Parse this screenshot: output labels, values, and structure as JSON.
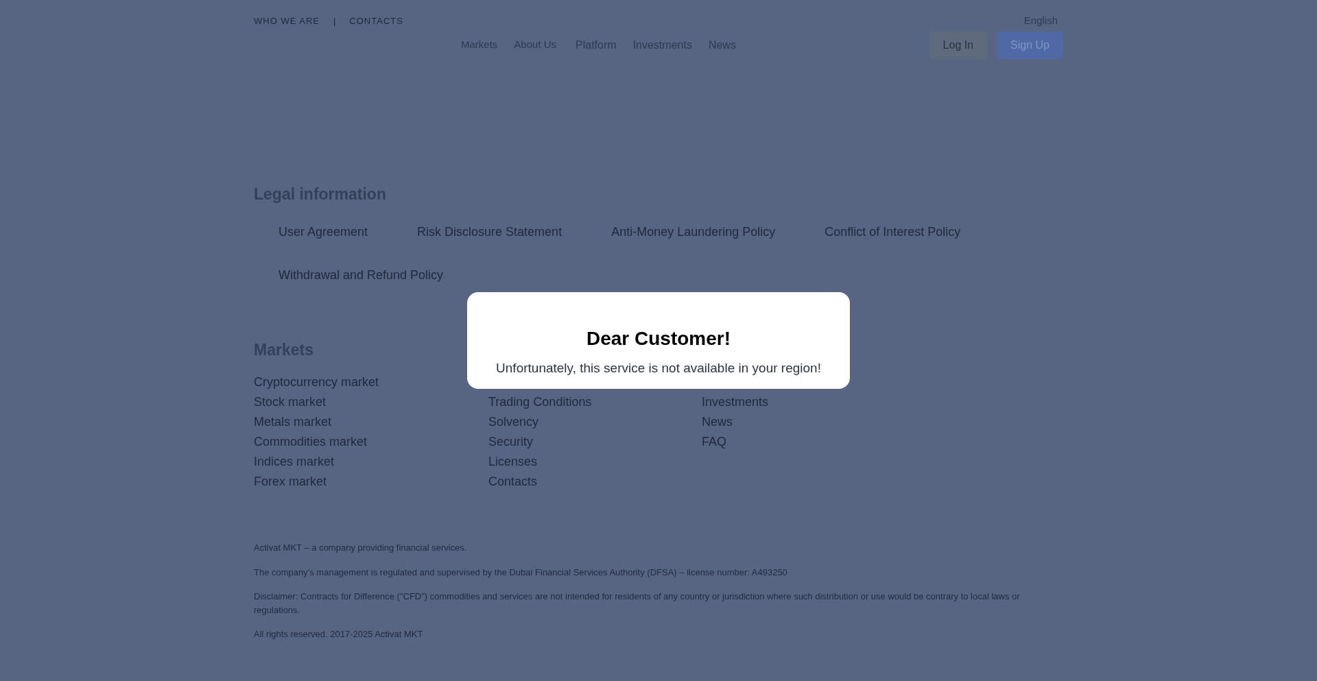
{
  "top_links": [
    "WHO WE ARE",
    "CONTACTS"
  ],
  "top_separator": "|",
  "language": "English",
  "nav": [
    "Markets",
    "About Us",
    "Platform",
    "Investments",
    "News"
  ],
  "auth_buttons": [
    {
      "label": "Log In",
      "kind": "login"
    },
    {
      "label": "Sign Up",
      "kind": "signup"
    }
  ],
  "legal": {
    "title": "Legal information",
    "links": [
      "User Agreement",
      "Risk Disclosure Statement",
      "Anti-Money Laundering Policy",
      "Conflict of Interest Policy",
      "Withdrawal and Refund Policy"
    ]
  },
  "footer_columns": [
    {
      "title": "Markets",
      "links": [
        "Cryptocurrency market",
        "Stock market",
        "Metals market",
        "Commodities market",
        "Indices market",
        "Forex market"
      ]
    },
    {
      "links": [
        "Trading Conditions",
        "Solvency",
        "Security",
        "Licenses",
        "Contacts"
      ]
    },
    {
      "links": [
        "Investments",
        "News",
        "FAQ"
      ]
    }
  ],
  "disclaimers": [
    "Activat MKT – a company providing financial services.",
    "The company's management is regulated and supervised by the Dubai Financial Services Authority (DFSA) – license number: A493250",
    "Disclaimer: Contracts for Difference (\"CFD\") commodities and services are not intended for residents of any country or jurisdiction where such distribution or use would be contrary to local laws or regulations.",
    "All rights reserved. 2017-2025 Activat MKT"
  ],
  "modal": {
    "title": "Dear Customer!",
    "message": "Unfortunately, this service is not available in your region!"
  }
}
